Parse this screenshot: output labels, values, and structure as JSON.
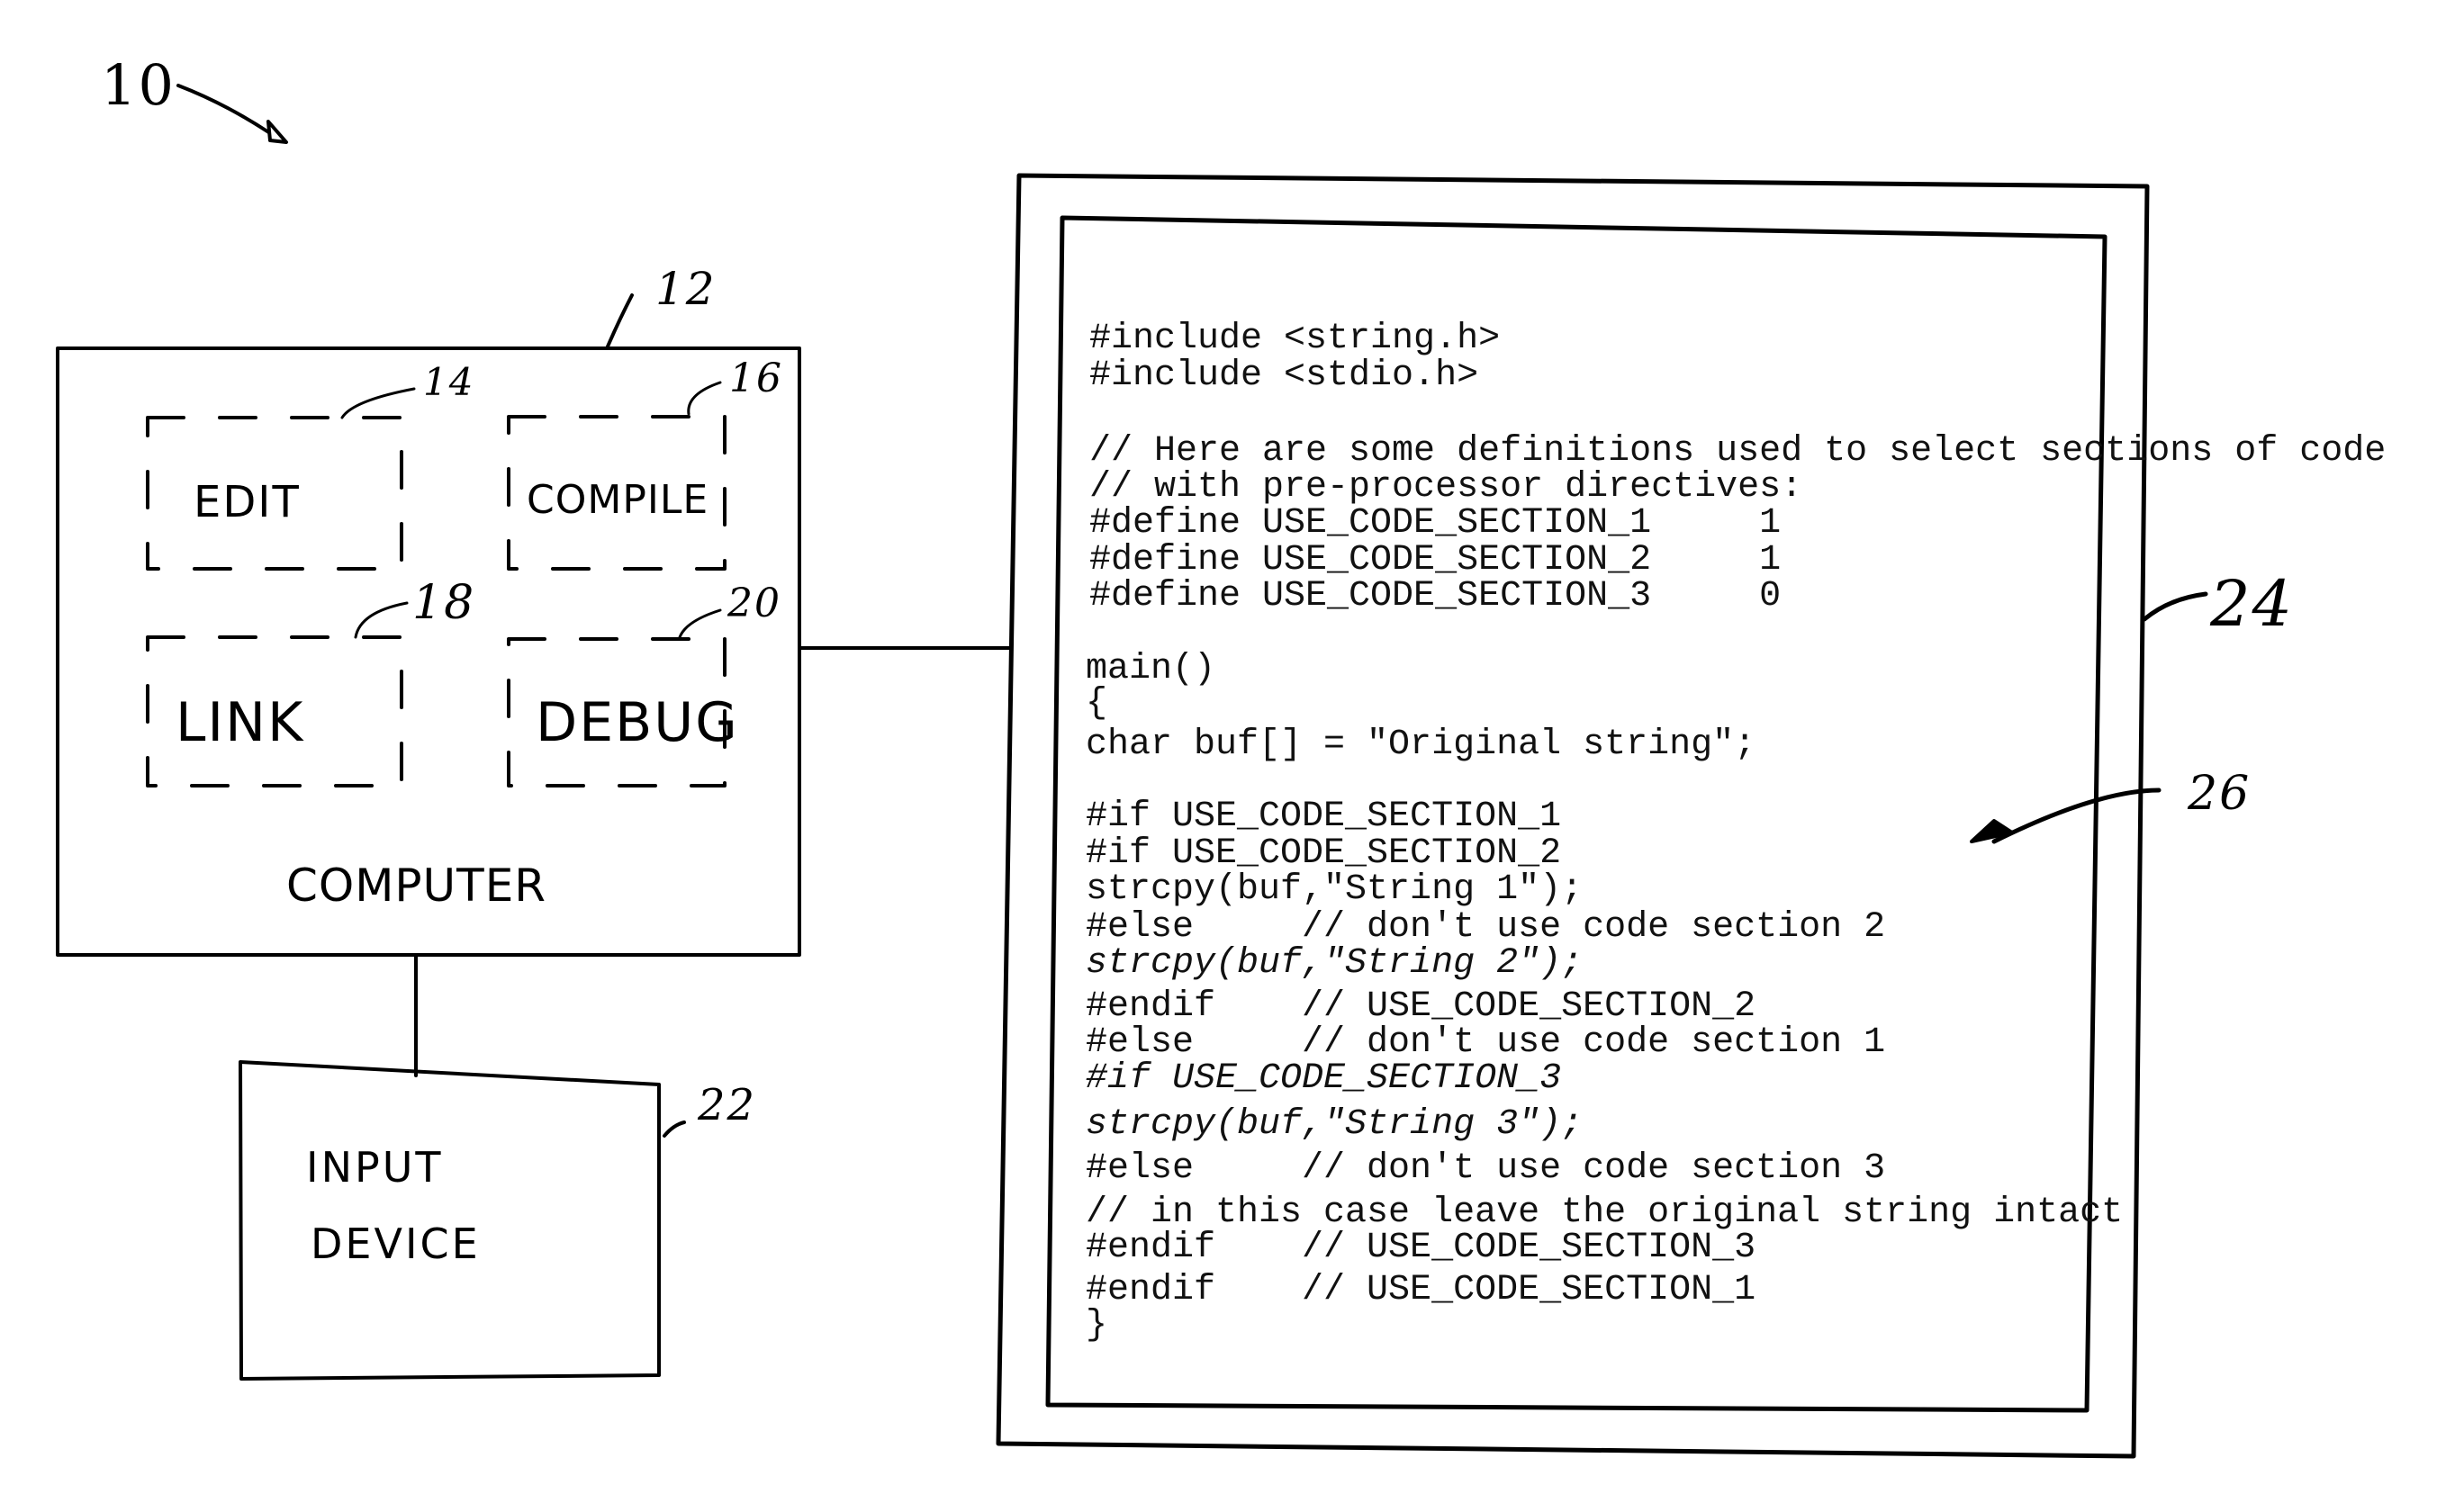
{
  "figure": {
    "system_ref": "10",
    "computer": {
      "ref": "12",
      "label": "COMPUTER",
      "modules": [
        {
          "ref": "14",
          "label": "EDIT"
        },
        {
          "ref": "16",
          "label": "COMPILE"
        },
        {
          "ref": "18",
          "label": "LINK"
        },
        {
          "ref": "20",
          "label": "DEBUG"
        }
      ]
    },
    "input_device": {
      "ref": "22",
      "label_lines": [
        "INPUT",
        "DEVICE"
      ]
    },
    "display": {
      "ref": "24",
      "code_ref": "26"
    }
  },
  "code": [
    {
      "text": "#include <string.h>",
      "italic": false
    },
    {
      "text": "#include <stdio.h>",
      "italic": false
    },
    {
      "text": "// Here are some definitions used to select sections of code",
      "italic": false
    },
    {
      "text": "// with pre-processor directives:",
      "italic": false
    },
    {
      "text": "#define USE_CODE_SECTION_1     1",
      "italic": false
    },
    {
      "text": "#define USE_CODE_SECTION_2     1",
      "italic": false
    },
    {
      "text": "#define USE_CODE_SECTION_3     0",
      "italic": false
    },
    {
      "text": "main()",
      "italic": false
    },
    {
      "text": "{",
      "italic": false
    },
    {
      "text": "char buf[] = \"Original string\";",
      "italic": false
    },
    {
      "text": "#if USE_CODE_SECTION_1",
      "italic": false
    },
    {
      "text": "#if USE_CODE_SECTION_2",
      "italic": false
    },
    {
      "text": "strcpy(buf,\"String 1\");",
      "italic": false
    },
    {
      "text": "#else     // don't use code section 2",
      "italic": false
    },
    {
      "text": "strcpy(buf,\"String 2\");",
      "italic": true
    },
    {
      "text": "#endif    // USE_CODE_SECTION_2",
      "italic": false
    },
    {
      "text": "#else     // don't use code section 1",
      "italic": false
    },
    {
      "text": "#if USE_CODE_SECTION_3",
      "italic": true
    },
    {
      "text": "strcpy(buf,\"String 3\");",
      "italic": true
    },
    {
      "text": "#else     // don't use code section 3",
      "italic": false
    },
    {
      "text": "// in this case leave the original string intact",
      "italic": false
    },
    {
      "text": "#endif    // USE_CODE_SECTION_3",
      "italic": false
    },
    {
      "text": "#endif    // USE_CODE_SECTION_1",
      "italic": false
    },
    {
      "text": "}",
      "italic": false
    }
  ]
}
